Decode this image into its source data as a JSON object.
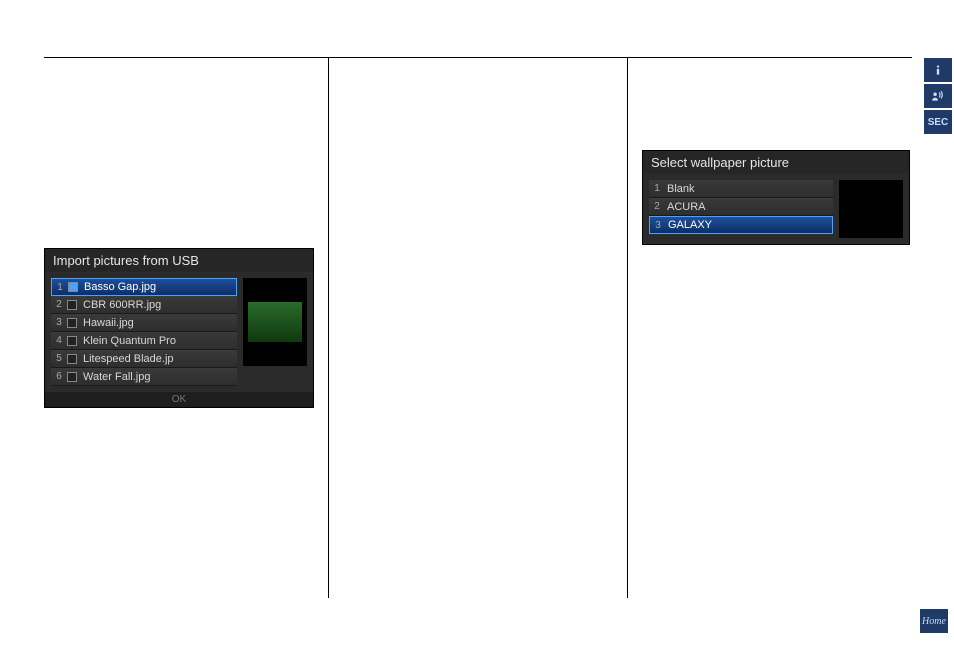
{
  "sidebar": {
    "info_label": "i",
    "voice_label": "voice",
    "sec_label": "SEC"
  },
  "home_label": "Home",
  "screen_import": {
    "title": "Import pictures from USB",
    "rows": [
      {
        "num": "1",
        "label": "Basso Gap.jpg",
        "checked": true,
        "selected": true
      },
      {
        "num": "2",
        "label": "CBR 600RR.jpg",
        "checked": false,
        "selected": false
      },
      {
        "num": "3",
        "label": "Hawaii.jpg",
        "checked": false,
        "selected": false
      },
      {
        "num": "4",
        "label": "Klein Quantum Pro",
        "checked": false,
        "selected": false
      },
      {
        "num": "5",
        "label": "Litespeed Blade.jp",
        "checked": false,
        "selected": false
      },
      {
        "num": "6",
        "label": "Water Fall.jpg",
        "checked": false,
        "selected": false
      }
    ],
    "footer": "OK"
  },
  "screen_wallpaper": {
    "title": "Select wallpaper picture",
    "rows": [
      {
        "num": "1",
        "label": "Blank",
        "selected": false
      },
      {
        "num": "2",
        "label": "ACURA",
        "selected": false
      },
      {
        "num": "3",
        "label": "GALAXY",
        "selected": true
      }
    ]
  }
}
